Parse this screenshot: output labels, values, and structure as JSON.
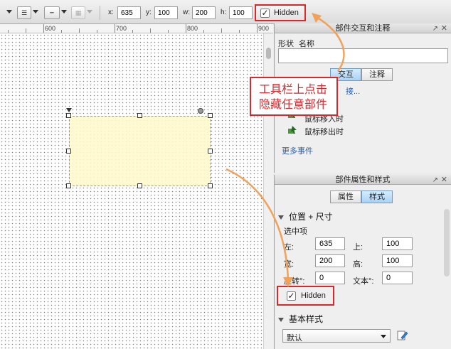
{
  "toolbar": {
    "x_label": "x:",
    "x_value": "635",
    "y_label": "y:",
    "y_value": "100",
    "w_label": "w:",
    "w_value": "200",
    "h_label": "h:",
    "h_value": "100",
    "hidden_label": "Hidden",
    "hidden_checked": "✓"
  },
  "ruler": {
    "labels": [
      "600",
      "700",
      "800",
      "900"
    ]
  },
  "interaction_panel": {
    "title": "部件交互和注释",
    "shape_label": "形状",
    "name_label": "名称",
    "name_value": "",
    "tabs": [
      "交互",
      "注释"
    ],
    "link_partial": "接...",
    "event_partial": "鼠标移入时",
    "event_mouse_out": "鼠标移出时",
    "more_events": "更多事件"
  },
  "props_panel": {
    "title": "部件属性和样式",
    "tabs": [
      "属性",
      "样式"
    ],
    "section_position": "位置 + 尺寸",
    "selected_label": "选中项",
    "left_label": "左:",
    "left_value": "635",
    "top_label": "上:",
    "top_value": "100",
    "width_label": "宽:",
    "width_value": "200",
    "height_label": "高:",
    "height_value": "100",
    "rotate_label": "旋转°:",
    "rotate_value": "0",
    "text_label": "文本°:",
    "text_value": "0",
    "hidden_label": "Hidden",
    "hidden_checked": "✓",
    "section_basic": "基本样式",
    "style_select": "默认"
  },
  "callout": {
    "line1": "工具栏上点击",
    "line2": "隐藏任意部件"
  },
  "colors": {
    "accent_red": "#d9272b",
    "arrow_orange": "#f0a25a",
    "tab_active": "#a8d2f4"
  }
}
